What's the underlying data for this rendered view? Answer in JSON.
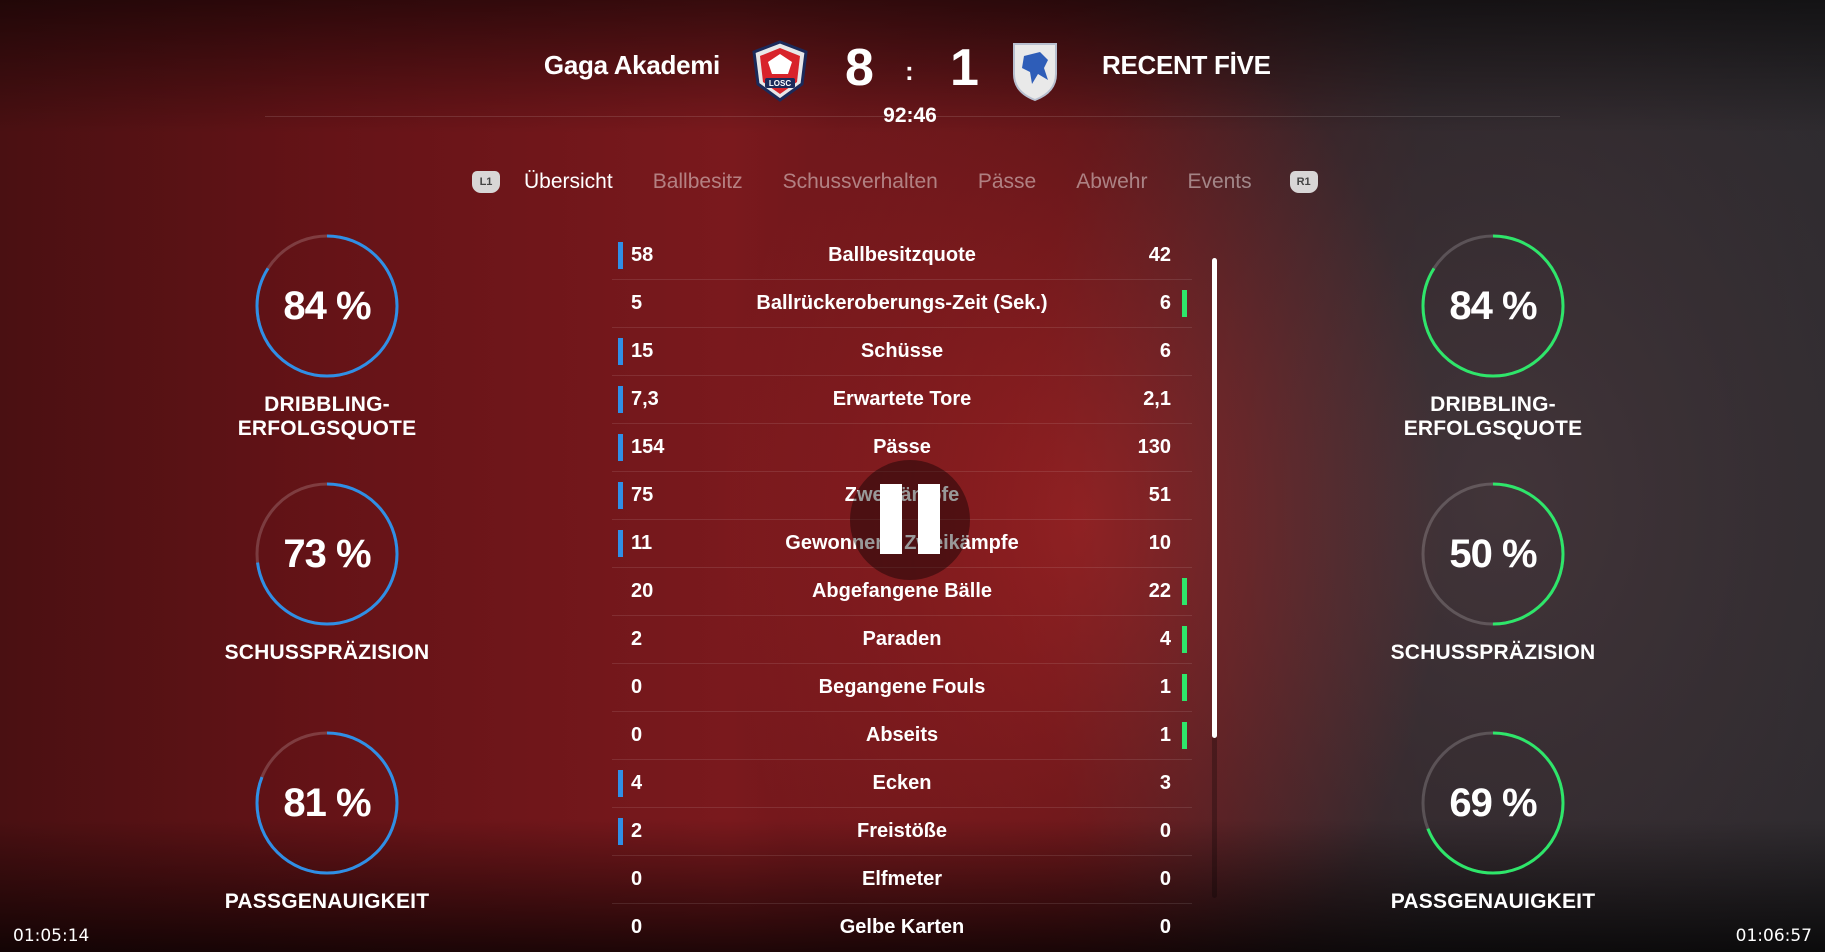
{
  "match": {
    "home_team": "Gaga Akademi",
    "away_team": "RECENT FİVE",
    "home_score": "8",
    "away_score": "1",
    "separator": ":",
    "clock": "92:46",
    "home_crest_text": "LOSC"
  },
  "tabs": {
    "left_bumper": "L1",
    "right_bumper": "R1",
    "items": [
      "Übersicht",
      "Ballbesitz",
      "Schussverhalten",
      "Pässe",
      "Abwehr",
      "Events"
    ],
    "active": "Übersicht"
  },
  "home_rings": [
    {
      "value": "84 %",
      "label": "DRIBBLING-ERFOLGSQUOTE",
      "fraction": 0.84
    },
    {
      "value": "73 %",
      "label": "SCHUSSPRÄZISION",
      "fraction": 0.73
    },
    {
      "value": "81 %",
      "label": "PASSGENAUIGKEIT",
      "fraction": 0.81
    }
  ],
  "away_rings": [
    {
      "value": "84 %",
      "label": "DRIBBLING-ERFOLGSQUOTE",
      "fraction": 0.84
    },
    {
      "value": "50 %",
      "label": "SCHUSSPRÄZISION",
      "fraction": 0.5
    },
    {
      "value": "69 %",
      "label": "PASSGENAUIGKEIT",
      "fraction": 0.69
    }
  ],
  "stats": [
    {
      "home": "58",
      "label": "Ballbesitzquote",
      "away": "42",
      "leader": "home"
    },
    {
      "home": "5",
      "label": "Ballrückeroberungs-Zeit (Sek.)",
      "away": "6",
      "leader": "away"
    },
    {
      "home": "15",
      "label": "Schüsse",
      "away": "6",
      "leader": "home"
    },
    {
      "home": "7,3",
      "label": "Erwartete Tore",
      "away": "2,1",
      "leader": "home"
    },
    {
      "home": "154",
      "label": "Pässe",
      "away": "130",
      "leader": "home"
    },
    {
      "home": "75",
      "label": "Zweikämpfe",
      "away": "51",
      "leader": "home"
    },
    {
      "home": "11",
      "label": "Gewonnene Zweikämpfe",
      "away": "10",
      "leader": "home"
    },
    {
      "home": "20",
      "label": "Abgefangene Bälle",
      "away": "22",
      "leader": "away"
    },
    {
      "home": "2",
      "label": "Paraden",
      "away": "4",
      "leader": "away"
    },
    {
      "home": "0",
      "label": "Begangene Fouls",
      "away": "1",
      "leader": "away"
    },
    {
      "home": "0",
      "label": "Abseits",
      "away": "1",
      "leader": "away"
    },
    {
      "home": "4",
      "label": "Ecken",
      "away": "3",
      "leader": "home"
    },
    {
      "home": "2",
      "label": "Freistöße",
      "away": "0",
      "leader": "home"
    },
    {
      "home": "0",
      "label": "Elfmeter",
      "away": "0",
      "leader": "none"
    },
    {
      "home": "0",
      "label": "Gelbe Karten",
      "away": "0",
      "leader": "none"
    }
  ],
  "player": {
    "current_time": "01:05:14",
    "total_time": "01:06:57",
    "state_icon": "pause-icon"
  },
  "colors": {
    "home_accent": "#2f8fe6",
    "away_accent": "#2ee66a"
  }
}
